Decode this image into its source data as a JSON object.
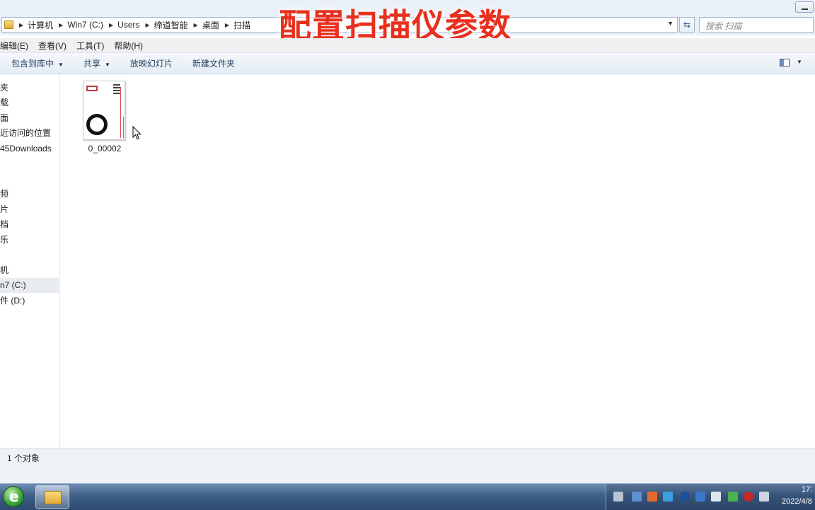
{
  "overlay": {
    "title": "配置扫描仪参数"
  },
  "address_bar": {
    "breadcrumbs": [
      "计算机",
      "Win7 (C:)",
      "Users",
      "缔道智能",
      "桌面",
      "扫描"
    ]
  },
  "search": {
    "placeholder": "搜索 扫描"
  },
  "menu": {
    "items": [
      "编辑(E)",
      "查看(V)",
      "工具(T)",
      "帮助(H)"
    ]
  },
  "toolbar": {
    "include_library": "包含到库中",
    "share": "共享",
    "slideshow": "放映幻灯片",
    "new_folder": "新建文件夹"
  },
  "nav": {
    "items": [
      "夹",
      "载",
      "面",
      "近访问的位置",
      "45Downloads",
      "频",
      "片",
      "档",
      "乐",
      "机",
      "n7 (C:)",
      "件 (D:)"
    ],
    "selected": "n7 (C:)"
  },
  "files": [
    {
      "name": "0_00002"
    }
  ],
  "status": {
    "text": "1 个对象"
  },
  "clock": {
    "time": "17:",
    "date": "2022/4/8"
  },
  "icons": {
    "folder": "folder-icon",
    "refresh": "refresh-icon",
    "start": "windows-start-icon",
    "explorer": "explorer-taskbar-icon"
  }
}
